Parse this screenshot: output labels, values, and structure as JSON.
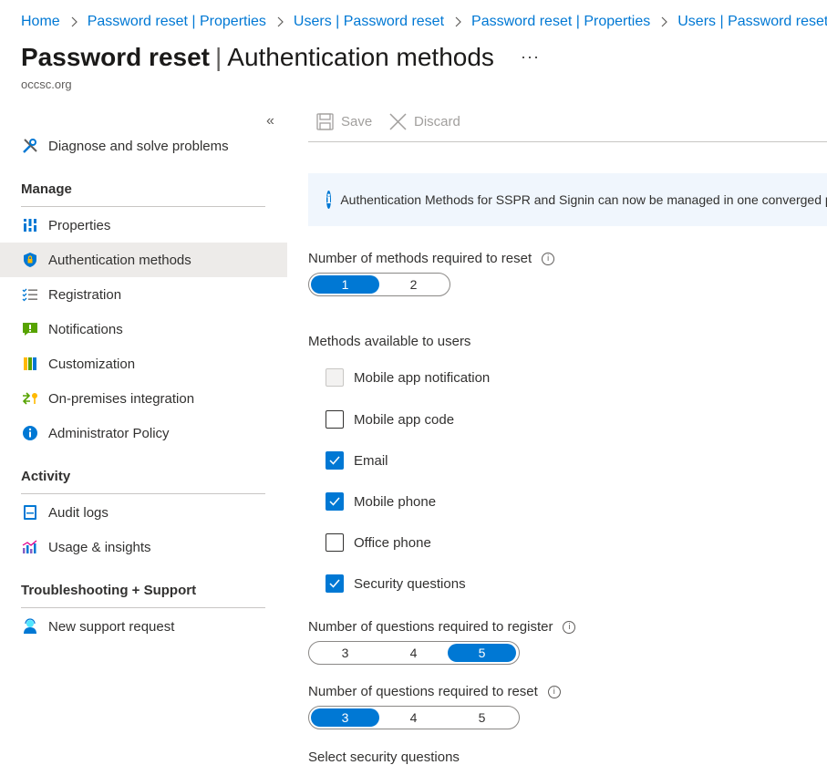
{
  "breadcrumb": [
    "Home",
    "Password reset | Properties",
    "Users | Password reset",
    "Password reset | Properties",
    "Users | Password reset"
  ],
  "header": {
    "title_bold": "Password reset",
    "title_rest": "Authentication methods",
    "more": "···",
    "subtitle": "occsc.org"
  },
  "sidebar": {
    "collapse": "«",
    "diagnose": "Diagnose and solve problems",
    "manage_heading": "Manage",
    "manage_items": [
      {
        "label": "Properties",
        "icon": "properties-icon"
      },
      {
        "label": "Authentication methods",
        "icon": "shield-icon"
      },
      {
        "label": "Registration",
        "icon": "checklist-icon"
      },
      {
        "label": "Notifications",
        "icon": "notification-icon"
      },
      {
        "label": "Customization",
        "icon": "customization-icon"
      },
      {
        "label": "On-premises integration",
        "icon": "on-premises-icon"
      },
      {
        "label": "Administrator Policy",
        "icon": "info-icon"
      }
    ],
    "activity_heading": "Activity",
    "activity_items": [
      {
        "label": "Audit logs",
        "icon": "audit-log-icon"
      },
      {
        "label": "Usage & insights",
        "icon": "chart-icon"
      }
    ],
    "support_heading": "Troubleshooting + Support",
    "support_items": [
      {
        "label": "New support request",
        "icon": "support-person-icon"
      }
    ]
  },
  "toolbar": {
    "save": "Save",
    "discard": "Discard"
  },
  "banner": {
    "text": "Authentication Methods for SSPR and Signin can now be managed in one converged policy."
  },
  "methods_required": {
    "label": "Number of methods required to reset",
    "options": [
      "1",
      "2"
    ],
    "selected": "1"
  },
  "methods_available": {
    "label": "Methods available to users",
    "items": [
      {
        "label": "Mobile app notification",
        "state": "disabled"
      },
      {
        "label": "Mobile app code",
        "state": "unchecked"
      },
      {
        "label": "Email",
        "state": "checked"
      },
      {
        "label": "Mobile phone",
        "state": "checked"
      },
      {
        "label": "Office phone",
        "state": "unchecked"
      },
      {
        "label": "Security questions",
        "state": "checked"
      }
    ]
  },
  "questions_register": {
    "label": "Number of questions required to register",
    "options": [
      "3",
      "4",
      "5"
    ],
    "selected": "5"
  },
  "questions_reset": {
    "label": "Number of questions required to reset",
    "options": [
      "3",
      "4",
      "5"
    ],
    "selected": "3"
  },
  "next_label": "Select security questions",
  "colors": {
    "accent": "#0078d4",
    "active_bg": "#edebe9",
    "banner_bg": "#f0f6fd"
  }
}
